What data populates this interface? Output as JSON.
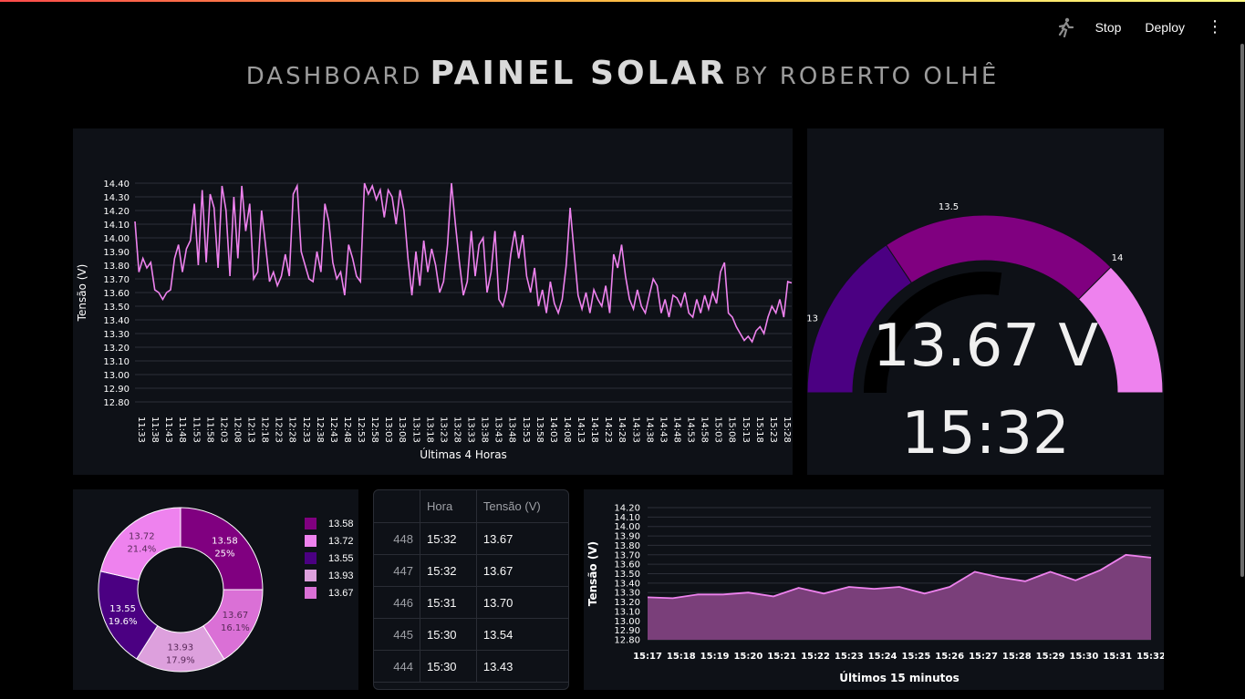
{
  "toolbar": {
    "stop_label": "Stop",
    "deploy_label": "Deploy",
    "running_icon": "running-man-icon",
    "menu_icon": "kebab-menu-icon"
  },
  "title": {
    "part1": "Dashboard",
    "part2": "Painel Solar",
    "part3": "by Roberto Olhê"
  },
  "colors": {
    "background": "#000000",
    "panel": "#0e1117",
    "line": "#ee82ee",
    "dark_purple": "#800080",
    "violet": "#4b0082",
    "light_violet": "#dda0dd",
    "orchid": "#da70d6"
  },
  "chart_data": [
    {
      "type": "line",
      "xlabel": "Últimas 4 Horas",
      "ylabel": "Tensão (V)",
      "ylim": [
        12.8,
        14.4
      ],
      "yticks": [
        "12.80",
        "12.90",
        "13.00",
        "13.10",
        "13.20",
        "13.30",
        "13.40",
        "13.50",
        "13.60",
        "13.70",
        "13.80",
        "13.90",
        "14.00",
        "14.10",
        "14.20",
        "14.30",
        "14.40"
      ],
      "xticks": [
        "11:33",
        "11:38",
        "11:43",
        "11:48",
        "11:53",
        "11:58",
        "12:03",
        "12:08",
        "12:13",
        "12:18",
        "12:23",
        "12:28",
        "12:33",
        "12:38",
        "12:43",
        "12:48",
        "12:53",
        "12:58",
        "13:03",
        "13:08",
        "13:13",
        "13:18",
        "13:23",
        "13:28",
        "13:33",
        "13:38",
        "13:43",
        "13:48",
        "13:53",
        "13:58",
        "14:03",
        "14:08",
        "14:13",
        "14:18",
        "14:23",
        "14:28",
        "14:33",
        "14:38",
        "14:43",
        "14:48",
        "14:53",
        "14:58",
        "15:03",
        "15:08",
        "15:13",
        "15:18",
        "15:23",
        "15:28"
      ],
      "values": [
        14.12,
        13.75,
        13.85,
        13.78,
        13.82,
        13.62,
        13.6,
        13.55,
        13.6,
        13.62,
        13.85,
        13.95,
        13.75,
        13.92,
        13.98,
        14.25,
        13.8,
        14.35,
        13.82,
        14.32,
        14.22,
        13.78,
        14.38,
        14.2,
        13.72,
        14.3,
        13.85,
        14.38,
        14.05,
        14.25,
        13.7,
        13.75,
        14.2,
        13.95,
        13.68,
        13.75,
        13.65,
        13.72,
        13.88,
        13.72,
        14.32,
        14.38,
        13.9,
        13.8,
        13.7,
        13.68,
        13.9,
        13.75,
        14.25,
        14.12,
        13.82,
        13.7,
        13.75,
        13.58,
        13.95,
        13.85,
        13.72,
        13.68,
        14.4,
        14.32,
        14.38,
        14.28,
        14.35,
        14.15,
        14.35,
        14.3,
        14.1,
        14.35,
        14.2,
        13.85,
        13.58,
        13.9,
        13.65,
        13.98,
        13.75,
        13.92,
        13.8,
        13.6,
        13.68,
        13.95,
        14.4,
        14.1,
        13.82,
        13.58,
        13.68,
        14.05,
        13.72,
        13.95,
        14.0,
        13.6,
        13.75,
        14.05,
        13.55,
        13.5,
        13.62,
        13.88,
        14.05,
        13.85,
        14.02,
        13.72,
        13.6,
        13.78,
        13.5,
        13.62,
        13.45,
        13.68,
        13.52,
        13.45,
        13.55,
        13.8,
        14.22,
        13.9,
        13.58,
        13.48,
        13.6,
        13.45,
        13.62,
        13.55,
        13.5,
        13.65,
        13.45,
        13.88,
        13.78,
        13.95,
        13.72,
        13.55,
        13.48,
        13.62,
        13.5,
        13.45,
        13.58,
        13.7,
        13.65,
        13.45,
        13.55,
        13.42,
        13.58,
        13.56,
        13.5,
        13.6,
        13.45,
        13.42,
        13.55,
        13.45,
        13.58,
        13.48,
        13.6,
        13.52,
        13.75,
        13.82,
        13.45,
        13.42,
        13.35,
        13.3,
        13.25,
        13.28,
        13.24,
        13.32,
        13.35,
        13.3,
        13.42,
        13.5,
        13.45,
        13.55,
        13.42,
        13.68,
        13.67
      ]
    },
    {
      "type": "gauge",
      "value": 13.67,
      "unit": "V",
      "ticks": [
        13,
        13.5,
        14
      ],
      "tick_labels": [
        "13",
        "13.5",
        "14"
      ],
      "range": [
        12.8,
        14.4
      ],
      "bands": [
        {
          "from": 12.8,
          "to": 13.3,
          "color": "#4b0082"
        },
        {
          "from": 13.3,
          "to": 14.0,
          "color": "#800080"
        },
        {
          "from": 14.0,
          "to": 14.4,
          "color": "#ee82ee"
        }
      ],
      "display_value": "13.67 V",
      "display_time": "15:32"
    },
    {
      "type": "pie",
      "hole": true,
      "slices": [
        {
          "label": "13.58",
          "percent_label": "25%",
          "value": 25.0,
          "color": "#800080",
          "text_color": "#ffffff"
        },
        {
          "label": "13.67",
          "percent_label": "16.1%",
          "value": 16.1,
          "color": "#da70d6",
          "text_color": "#5a2a5a"
        },
        {
          "label": "13.93",
          "percent_label": "17.9%",
          "value": 17.9,
          "color": "#dda0dd",
          "text_color": "#5a2a5a"
        },
        {
          "label": "13.55",
          "percent_label": "19.6%",
          "value": 19.6,
          "color": "#4b0082",
          "text_color": "#ffffff"
        },
        {
          "label": "13.72",
          "percent_label": "21.4%",
          "value": 21.4,
          "color": "#ee82ee",
          "text_color": "#5a2a5a"
        }
      ],
      "legend": [
        {
          "label": "13.58",
          "color": "#800080"
        },
        {
          "label": "13.72",
          "color": "#ee82ee"
        },
        {
          "label": "13.55",
          "color": "#4b0082"
        },
        {
          "label": "13.93",
          "color": "#dda0dd"
        },
        {
          "label": "13.67",
          "color": "#da70d6"
        }
      ]
    },
    {
      "type": "table",
      "columns": [
        "",
        "Hora",
        "Tensão (V)"
      ],
      "rows": [
        [
          "448",
          "15:32",
          "13.67"
        ],
        [
          "447",
          "15:32",
          "13.67"
        ],
        [
          "446",
          "15:31",
          "13.70"
        ],
        [
          "445",
          "15:30",
          "13.54"
        ],
        [
          "444",
          "15:30",
          "13.43"
        ]
      ]
    },
    {
      "type": "area",
      "xlabel": "Últimos 15 minutos",
      "ylabel": "Tensão (V)",
      "ylim": [
        12.8,
        14.2
      ],
      "yticks": [
        "12.80",
        "12.90",
        "13.00",
        "13.10",
        "13.20",
        "13.30",
        "13.40",
        "13.50",
        "13.60",
        "13.70",
        "13.80",
        "13.90",
        "14.00",
        "14.10",
        "14.20"
      ],
      "xticks": [
        "15:17",
        "15:18",
        "15:19",
        "15:20",
        "15:21",
        "15:22",
        "15:23",
        "15:24",
        "15:25",
        "15:26",
        "15:27",
        "15:28",
        "15:29",
        "15:30",
        "15:31",
        "15:32"
      ],
      "x": [
        15.17,
        15.18,
        15.19,
        15.2,
        15.21,
        15.215,
        15.22,
        15.23,
        15.24,
        15.245,
        15.25,
        15.26,
        15.27,
        15.275,
        15.28,
        15.29,
        15.3,
        15.305,
        15.31,
        15.32
      ],
      "values": [
        13.25,
        13.24,
        13.28,
        13.28,
        13.3,
        13.26,
        13.35,
        13.29,
        13.36,
        13.34,
        13.36,
        13.29,
        13.36,
        13.52,
        13.46,
        13.42,
        13.52,
        13.43,
        13.54,
        13.7,
        13.67
      ]
    }
  ]
}
